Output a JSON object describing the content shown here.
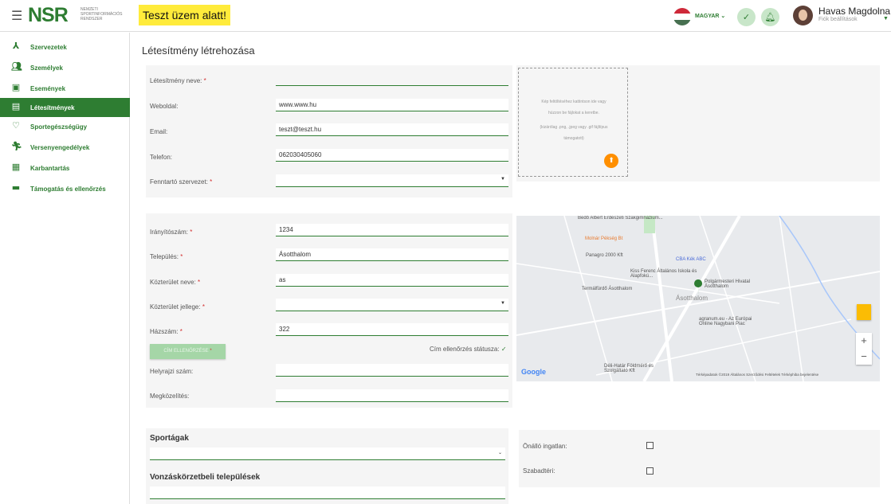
{
  "header": {
    "menu_icon": "☰",
    "logo": "NSR",
    "logo_sub": "NEMZETI SPORTINFORMÁCIÓS RENDSZER",
    "test_banner": "Teszt üzem alatt!",
    "language": "MAGYAR",
    "user_name": "Havas Magdolna",
    "user_sub": "Fiók beállítások"
  },
  "sidebar": {
    "items": [
      {
        "label": "Szervezetek",
        "icon": "organization-icon"
      },
      {
        "label": "Személyek",
        "icon": "people-icon"
      },
      {
        "label": "Események",
        "icon": "calendar-icon"
      },
      {
        "label": "Létesítmények",
        "icon": "building-icon",
        "active": true
      },
      {
        "label": "Sportegészségügy",
        "icon": "heart-icon"
      },
      {
        "label": "Versenyengedélyek",
        "icon": "runner-icon"
      },
      {
        "label": "Karbantartás",
        "icon": "clipboard-icon"
      },
      {
        "label": "Támogatás és ellenőrzés",
        "icon": "briefcase-icon"
      }
    ]
  },
  "page": {
    "title": "Létesítmény létrehozása"
  },
  "basic": {
    "name_label": "Létesítmény neve:",
    "name_value": "",
    "website_label": "Weboldal:",
    "website_value": "www.www.hu",
    "email_label": "Email:",
    "email_value": "teszt@teszt.hu",
    "phone_label": "Telefon:",
    "phone_value": "062030405060",
    "operator_label": "Fenntartó szervezet:",
    "operator_value": ""
  },
  "upload": {
    "line1": "Kép feltöltéséhez kattintson ide vagy",
    "line2": "húzzon be fájlokat a keretbe.",
    "line3": "(kizárólag .png, .jpeg vagy .gif fájltípus",
    "line4": "támogatott)"
  },
  "address": {
    "zip_label": "Irányítószám:",
    "zip_value": "1234",
    "city_label": "Település:",
    "city_value": "Ásotthalom",
    "street_label": "Közterület neve:",
    "street_value": "as",
    "street_type_label": "Közterület jellege:",
    "street_type_value": "",
    "number_label": "Házszám:",
    "number_value": "322",
    "check_button": "CÍM ELLENŐRZÉSE",
    "status_label": "Cím ellenőrzés státusza:",
    "parcel_label": "Helyrajzi szám:",
    "parcel_value": "",
    "access_label": "Megközelítés:",
    "access_value": ""
  },
  "map": {
    "labels": {
      "school1": "Bedő Albert Erdészeti Szakgimnázium...",
      "bakery": "Molnár Pékség Bt",
      "panagro": "Panagro 2000 Kft",
      "cba": "CBA Kék ABC",
      "school2": "Kiss Ferenc Általános Iskola és Alapfokú...",
      "mayor": "Polgármesteri Hivatal Ásotthalom",
      "spa": "Termálfürdő Ásotthalom",
      "town": "Ásotthalom",
      "agranum": "agranum.eu - Az Európai Online Nagybani Piac",
      "delhatar": "Déli-Határ Földmérő és Szolgáltató Kft",
      "google": "Google",
      "attribution": "Térképadatok ©2019   Általános Szerződési Feltételek   Térképhiba bejelentése"
    }
  },
  "sports": {
    "title": "Sportágak",
    "zone_title": "Vonzáskörzetbeli települések"
  },
  "property": {
    "standalone_label": "Önálló ingatlan:",
    "outdoor_label": "Szabadtéri:"
  },
  "colors": {
    "brand": "#2e7d32",
    "banner": "#ffeb3b",
    "upload_button": "#ff8f00"
  }
}
